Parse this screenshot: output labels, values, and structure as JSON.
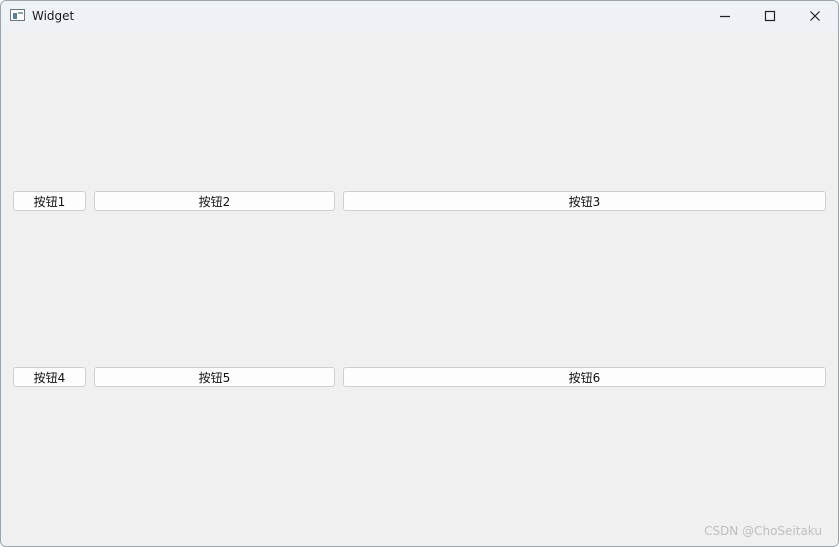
{
  "window": {
    "title": "Widget",
    "icon": "app-window-icon",
    "controls": {
      "minimize_icon": "minimize-icon",
      "maximize_icon": "maximize-icon",
      "close_icon": "close-icon"
    }
  },
  "buttons": {
    "row1": [
      "按钮1",
      "按钮2",
      "按钮3"
    ],
    "row2": [
      "按钮4",
      "按钮5",
      "按钮6"
    ]
  },
  "watermark": "CSDN @ChoSeitaku",
  "colors": {
    "titlebar": "#eef2f6",
    "window_background": "#f0f0f0",
    "button_background": "#fdfdfd",
    "button_border": "#cfcfcf"
  }
}
